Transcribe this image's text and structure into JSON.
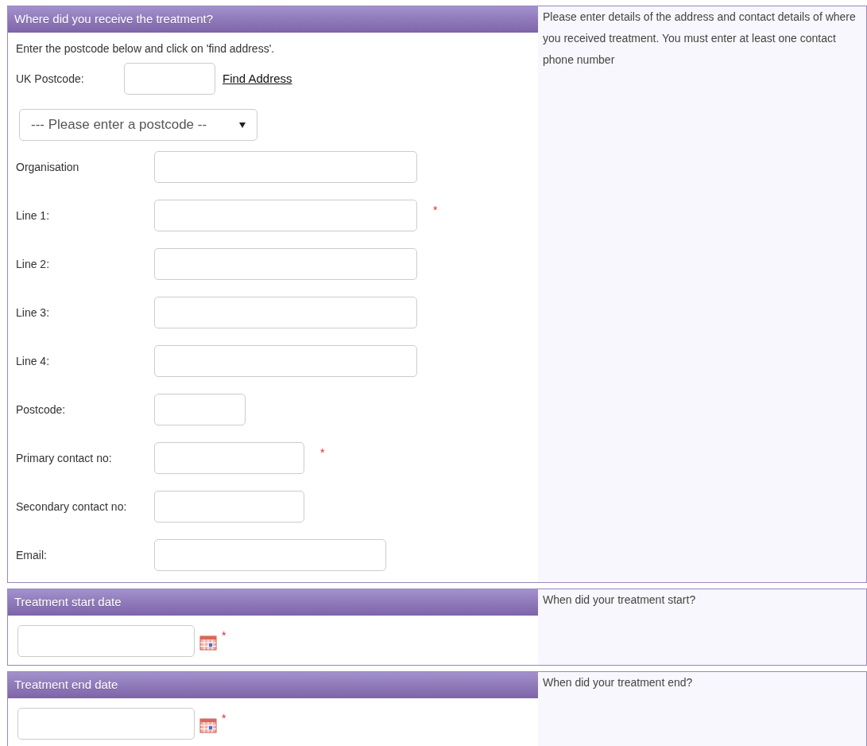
{
  "sections": [
    {
      "kind": "address",
      "title": "Where did you receive the treatment?",
      "help": "Please enter details of the address and contact details of where you received treatment. You must enter at least one contact phone number",
      "intro": "Enter the postcode below and click on 'find address'.",
      "lookup": {
        "label": "UK Postcode:",
        "link": "Find Address",
        "select_placeholder": "--- Please enter a postcode --"
      },
      "fields": [
        {
          "label": "Organisation",
          "kind": "text"
        },
        {
          "label": "Line 1:",
          "kind": "text",
          "required_mark": "*"
        },
        {
          "label": "Line 2:",
          "kind": "text"
        },
        {
          "label": "Line 3:",
          "kind": "text"
        },
        {
          "label": "Line 4:",
          "kind": "text"
        },
        {
          "label": "Postcode:",
          "kind": "postcode"
        },
        {
          "label": "Primary contact no:",
          "kind": "phone",
          "required_mark": "*"
        },
        {
          "label": "Secondary contact no:",
          "kind": "phone"
        },
        {
          "label": "Email:",
          "kind": "email"
        }
      ]
    },
    {
      "kind": "date",
      "title": "Treatment start date",
      "help": "When did your treatment start?",
      "required_mark": "*"
    },
    {
      "kind": "date",
      "title": "Treatment end date",
      "help": "When did your treatment end?",
      "required_mark": "*"
    }
  ]
}
